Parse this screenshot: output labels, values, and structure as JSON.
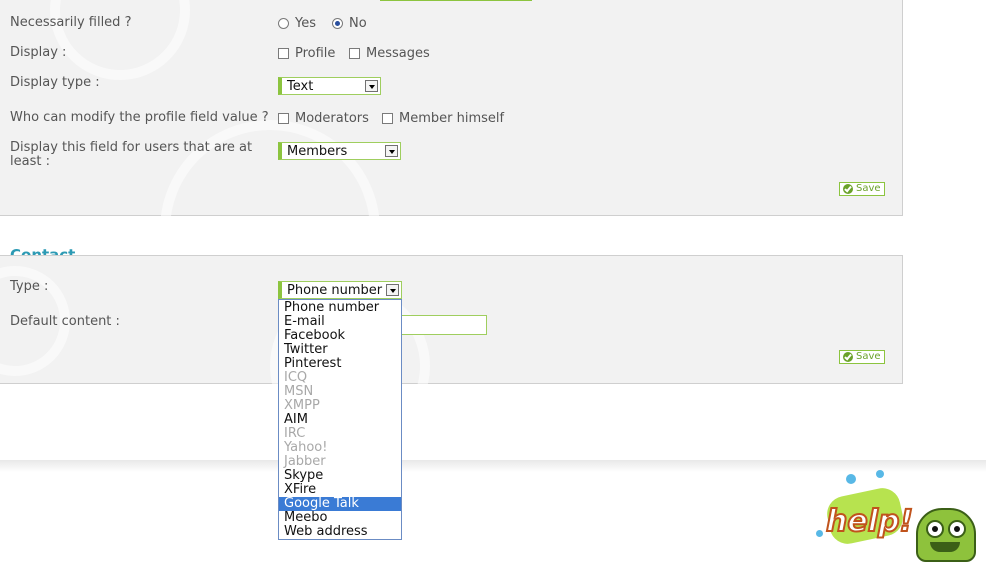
{
  "field_settings": {
    "necessarily_filled": {
      "label": "Necessarily filled ?",
      "options": [
        "Yes",
        "No"
      ],
      "selected": "No"
    },
    "display": {
      "label": "Display :",
      "options": [
        "Profile",
        "Messages"
      ]
    },
    "display_type": {
      "label": "Display type :",
      "value": "Text"
    },
    "who_can_modify": {
      "label": "Who can modify the profile field value ?",
      "options": [
        "Moderators",
        "Member himself"
      ]
    },
    "display_for": {
      "label_line1": "Display this field for users that are at",
      "label_line2": "least :",
      "value": "Members"
    },
    "save_label": "Save"
  },
  "contact": {
    "title": "Contact",
    "type_label": "Type :",
    "type_value": "Phone number",
    "default_content_label": "Default content :",
    "save_label": "Save",
    "dropdown_options": [
      {
        "label": "Phone number",
        "state": "normal"
      },
      {
        "label": "E-mail",
        "state": "normal"
      },
      {
        "label": "Facebook",
        "state": "normal"
      },
      {
        "label": "Twitter",
        "state": "normal"
      },
      {
        "label": "Pinterest",
        "state": "normal"
      },
      {
        "label": "ICQ",
        "state": "disabled"
      },
      {
        "label": "MSN",
        "state": "disabled"
      },
      {
        "label": "XMPP",
        "state": "disabled"
      },
      {
        "label": "AIM",
        "state": "normal"
      },
      {
        "label": "IRC",
        "state": "disabled"
      },
      {
        "label": "Yahoo!",
        "state": "disabled"
      },
      {
        "label": "Jabber",
        "state": "disabled"
      },
      {
        "label": "Skype",
        "state": "normal"
      },
      {
        "label": "XFire",
        "state": "normal"
      },
      {
        "label": "Google Talk",
        "state": "highlighted"
      },
      {
        "label": "Meebo",
        "state": "normal"
      },
      {
        "label": "Web address",
        "state": "normal"
      }
    ]
  },
  "help_logo": {
    "text": "help!"
  },
  "colors": {
    "accent_green": "#8cc43f",
    "title_blue": "#2c9ab4",
    "highlight_blue": "#3a7bd5",
    "disabled_gray": "#a8a8a8"
  }
}
